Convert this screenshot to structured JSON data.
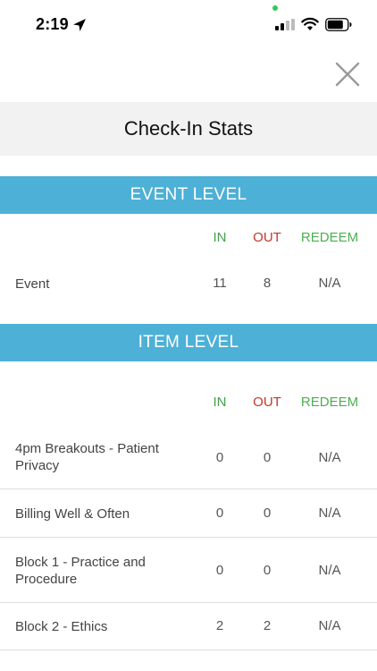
{
  "status": {
    "time": "2:19"
  },
  "header": {
    "title": "Check-In Stats"
  },
  "event_level": {
    "title": "EVENT LEVEL",
    "columns": {
      "in": "IN",
      "out": "OUT",
      "redeem": "REDEEM"
    },
    "rows": [
      {
        "label": "Event",
        "in": "11",
        "out": "8",
        "redeem": "N/A"
      }
    ]
  },
  "item_level": {
    "title": "ITEM LEVEL",
    "columns": {
      "in": "IN",
      "out": "OUT",
      "redeem": "REDEEM"
    },
    "rows": [
      {
        "label": "4pm Breakouts - Patient Privacy",
        "in": "0",
        "out": "0",
        "redeem": "N/A"
      },
      {
        "label": "Billing Well & Often",
        "in": "0",
        "out": "0",
        "redeem": "N/A"
      },
      {
        "label": "Block 1 - Practice and Procedure",
        "in": "0",
        "out": "0",
        "redeem": "N/A"
      },
      {
        "label": "Block 2 - Ethics",
        "in": "2",
        "out": "2",
        "redeem": "N/A"
      }
    ]
  },
  "colors": {
    "header_blue": "#4db0d6",
    "in_green": "#43a047",
    "out_red": "#c0392b",
    "redeem_green": "#4caf50"
  },
  "icons": {
    "close": "close-icon",
    "location": "location-arrow-icon",
    "signal": "cellular-signal-icon",
    "wifi": "wifi-icon",
    "battery": "battery-icon"
  }
}
